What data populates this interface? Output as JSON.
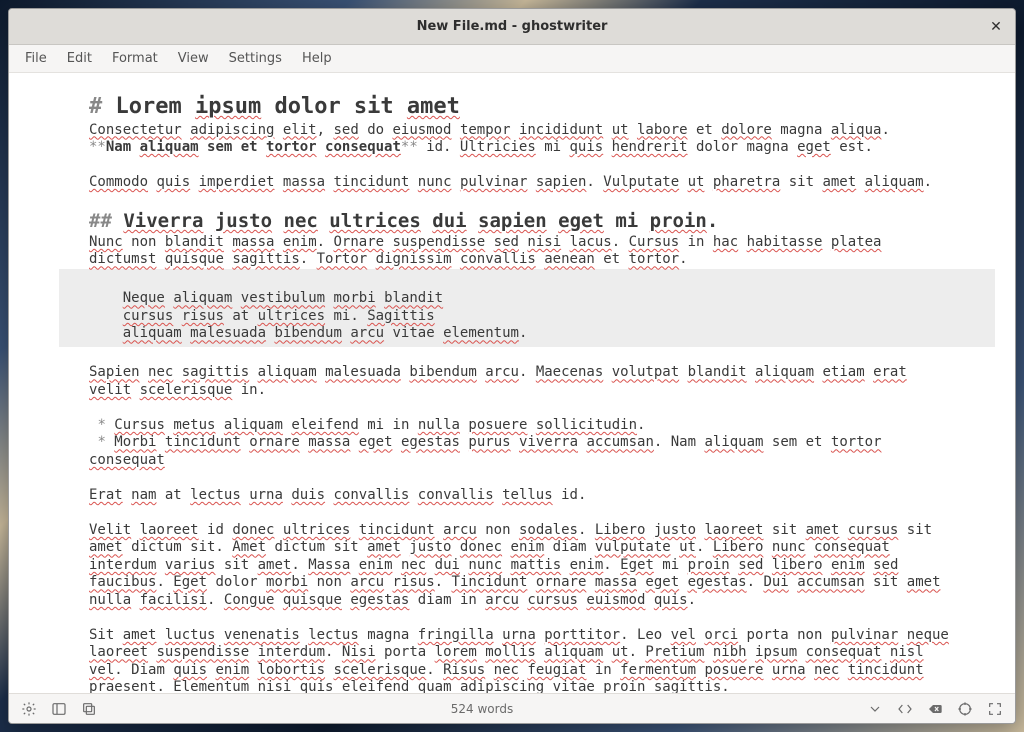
{
  "window": {
    "title": "New File.md - ghostwriter",
    "close_glyph": "✕"
  },
  "menu": {
    "items": [
      "File",
      "Edit",
      "Format",
      "View",
      "Settings",
      "Help"
    ]
  },
  "status": {
    "words": "524 words"
  },
  "editor": {
    "h1_marker": "# ",
    "h1_plain1": "Lorem ",
    "h1_sp1": "ipsum",
    "h1_plain2": " dolor sit ",
    "h1_sp2": "amet",
    "p1_a": "Consectetur",
    "p1_b": "adipiscing",
    "p1_c": "elit",
    "p1_d": "sed",
    "p1_e": "eiusmod",
    "p1_f": "tempor",
    "p1_g": "incididunt",
    "p1_h": "ut",
    "p1_i": "labore",
    "p1_j": "dolore",
    "p1_k": "aliqua",
    "bold_marker": "**",
    "p2_a": "Nam ",
    "p2_b": "aliquam",
    "p2_c": " sem et ",
    "p2_d": "tortor",
    "p2_e": "consequat",
    "p2_f": "Ultricies",
    "p2_g": "quis",
    "p2_h": "hendrerit",
    "p2_i": "eget",
    "p3_a": "Commodo",
    "p3_b": "quis",
    "p3_c": "imperdiet",
    "p3_d": "massa",
    "p3_e": "tincidunt",
    "p3_f": "nunc",
    "p3_g": "pulvinar",
    "p3_h": "sapien",
    "p3_i": "Vulputate",
    "p3_j": "ut",
    "p3_k": "pharetra",
    "p3_l": "amet",
    "p3_m": "aliquam",
    "h2_marker": "## ",
    "h2_a": "Viverra",
    "h2_b": "justo",
    "h2_c": "nec",
    "h2_d": "ultrices",
    "h2_e": "dui",
    "h2_f": "sapien",
    "h2_g": "eget",
    "h2_h": "proin",
    "p4_a": "Nunc",
    "p4_b": "blandit",
    "p4_c": "massa",
    "p4_d": "enim",
    "p4_e": "Ornare",
    "p4_f": "suspendisse",
    "p4_g": "sed",
    "p4_h": "nisi",
    "p4_i": "lacus",
    "p4_j": "Cursus",
    "p4_k": "hac",
    "p4_l": "habitasse",
    "p4_m": "platea",
    "p4_n": "dictumst",
    "p4_o": "quisque",
    "p4_p": "sagittis",
    "p4_q": "Tortor",
    "p4_r": "dignissim",
    "p4_s": "convallis",
    "p4_t": "aenean",
    "p4_u": "tortor",
    "blk1_a": "Neque",
    "blk1_b": "aliquam",
    "blk1_c": "vestibulum",
    "blk1_d": "morbi",
    "blk1_e": "blandit",
    "blk2_a": "cursus",
    "blk2_b": "risus",
    "blk2_c": "ultrices",
    "blk2_d": "Sagittis",
    "blk3_a": "aliquam",
    "blk3_b": "malesuada",
    "blk3_c": "bibendum",
    "blk3_d": "arcu",
    "blk3_e": "elementum",
    "p5_a": "Sapien",
    "p5_b": "nec",
    "p5_c": "sagittis",
    "p5_d": "aliquam",
    "p5_e": "malesuada",
    "p5_f": "bibendum",
    "p5_g": "arcu",
    "p5_h": "Maecenas",
    "p5_i": "volutpat",
    "p5_j": "blandit",
    "p5_k": "aliquam",
    "p5_l": "etiam",
    "p5_m": "erat",
    "p5_n": "velit",
    "p5_o": "scelerisque",
    "li_marker": " * ",
    "li1_a": "Cursus",
    "li1_b": "metus",
    "li1_c": "aliquam",
    "li1_d": "eleifend",
    "li1_e": "nulla",
    "li1_f": "posuere",
    "li1_g": "sollicitudin",
    "li2_a": "Morbi",
    "li2_b": "tincidunt",
    "li2_c": "ornare",
    "li2_d": "massa",
    "li2_e": "eget",
    "li2_f": "egestas",
    "li2_g": "purus",
    "li2_h": "viverra",
    "li2_i": "accumsan",
    "li2_j": "aliquam",
    "li2_k": "tortor",
    "li2_l": "consequat",
    "p6_a": "Erat",
    "p6_b": "nam",
    "p6_c": "lectus",
    "p6_d": "urna",
    "p6_e": "duis",
    "p6_f": "convallis",
    "p6_g": "convallis",
    "p6_h": "tellus",
    "p7_a": "Velit",
    "p7_b": "laoreet",
    "p7_c": "donec",
    "p7_d": "ultrices",
    "p7_e": "tincidunt",
    "p7_f": "arcu",
    "p7_g": "sodales",
    "p7_h": "Libero",
    "p7_i": "justo",
    "p7_j": "laoreet",
    "p7_k": "amet",
    "p7_l": "cursus",
    "p7_m": "amet",
    "p7_n": "Amet",
    "p7_o": "amet",
    "p7_p": "justo",
    "p7_q": "donec",
    "p7_r": "enim",
    "p7_s": "vulputate",
    "p7_t": "ut",
    "p7_u": "Libero",
    "p7_v": "nunc",
    "p7_w": "consequat",
    "p7_x": "interdum",
    "p7_y": "varius",
    "p7_z": "amet",
    "p7_aa": "Massa",
    "p7_ab": "enim",
    "p7_ac": "nec",
    "p7_ad": "dui",
    "p7_ae": "nunc",
    "p7_af": "mattis",
    "p7_ag": "enim",
    "p7_ah": "Eget",
    "p7_ai": "proin",
    "p7_aj": "sed",
    "p7_ak": "libero",
    "p7_al": "enim",
    "p7_am": "sed",
    "p7_an": "faucibus",
    "p7_ao": "Eget",
    "p7_ap": "morbi",
    "p7_aq": "arcu",
    "p7_ar": "risus",
    "p7_as": "Tincidunt",
    "p7_at": "ornare",
    "p7_au": "massa",
    "p7_av": "eget",
    "p7_aw": "egestas",
    "p7_ax": "Dui",
    "p7_ay": "accumsan",
    "p7_az": "amet",
    "p7_ba": "nulla",
    "p7_bb": "facilisi",
    "p7_bc": "Congue",
    "p7_bd": "quisque",
    "p7_be": "egestas",
    "p7_bf": "arcu",
    "p7_bg": "cursus",
    "p7_bh": "euismod",
    "p7_bi": "quis",
    "p8_a": "amet",
    "p8_b": "luctus",
    "p8_c": "venenatis",
    "p8_d": "lectus",
    "p8_e": "fringilla",
    "p8_f": "urna",
    "p8_g": "porttitor",
    "p8_h": "vel",
    "p8_i": "orci",
    "p8_j": "pulvinar",
    "p8_k": "neque",
    "p8_l": "laoreet",
    "p8_m": "suspendisse",
    "p8_n": "interdum",
    "p8_o": "Nisi",
    "p8_p": "lorem",
    "p8_q": "mollis",
    "p8_r": "aliquam",
    "p8_s": "ut",
    "p8_t": "Pretium",
    "p8_u": "nibh",
    "p8_v": "ipsum",
    "p8_w": "consequat",
    "p8_x": "nisl",
    "p8_y": "vel",
    "p8_z": "quis",
    "p8_aa": "enim",
    "p8_ab": "lobortis",
    "p8_ac": "scelerisque",
    "p8_ad": "Risus",
    "p8_ae": "nec",
    "p8_af": "feugiat",
    "p8_ag": "fermentum",
    "p8_ah": "posuere",
    "p8_ai": "urna",
    "p8_aj": "nec",
    "p8_ak": "tincidunt",
    "p8_al": "praesent",
    "p8_am": "Elementum",
    "p8_an": "nisi",
    "p8_ao": "quis",
    "p8_ap": "eleifend",
    "p8_aq": "quam",
    "p8_ar": "adipiscing",
    "p8_as": "proin",
    "p8_at": "sagittis"
  },
  "icons": {
    "gear": "gear",
    "sidebar": "sidebar",
    "copy": "copy",
    "dropdown": "dropdown",
    "code": "code",
    "backspace": "backspace",
    "target": "target",
    "fullscreen": "fullscreen"
  }
}
